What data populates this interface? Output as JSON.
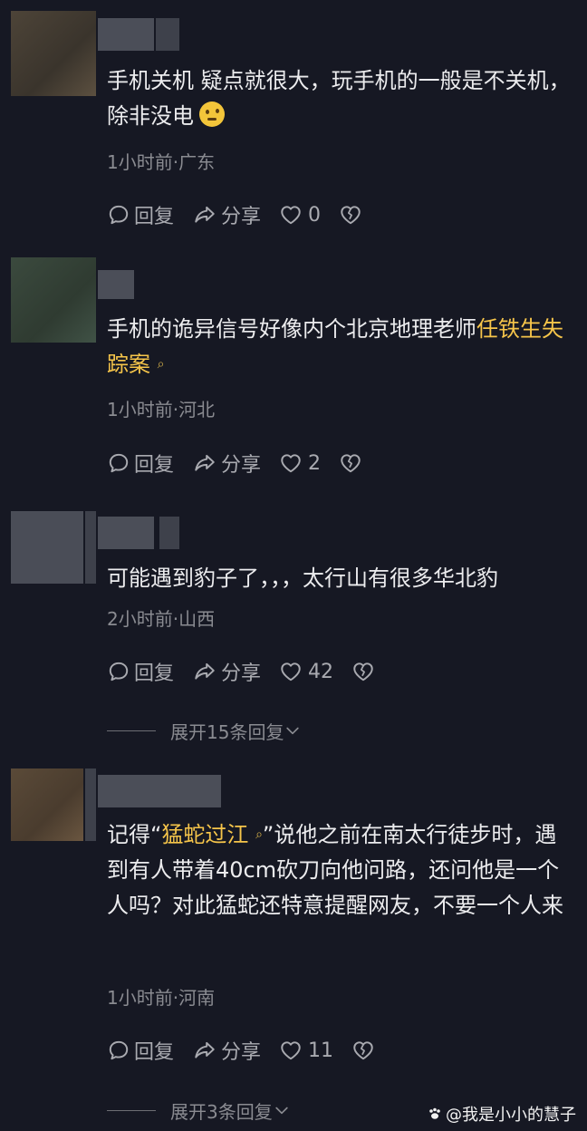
{
  "comments": [
    {
      "text": "手机关机 疑点就很大，玩手机的一般是不关机，除非没电",
      "meta": "1小时前·广东",
      "likes": "0"
    },
    {
      "text_before": "手机的诡异信号好像内个北京地理老师",
      "link": "任铁生失踪案",
      "meta": "1小时前·河北",
      "likes": "2"
    },
    {
      "text": "可能遇到豹子了，，，太行山有很多华北豹",
      "meta": "2小时前·山西",
      "likes": "42",
      "expand": "展开15条回复"
    },
    {
      "text_before": "记得“",
      "link": "猛蛇过江",
      "text_after": "”说他之前在南太行徒步时，遇到有人带着40cm砍刀向他问路，还问他是一个人吗？对此猛蛇还特意提醒网友，不要一个人来",
      "meta": "1小时前·河南",
      "likes": "11",
      "expand": "展开3条回复"
    }
  ],
  "actions": {
    "reply": "回复",
    "share": "分享"
  },
  "icons": [
    "comment-bubble-icon",
    "share-arrow-icon",
    "heart-icon",
    "broken-heart-icon",
    "chevron-down-icon",
    "search-icon",
    "thinking-face-emoji"
  ],
  "watermark": "@我是小小的慧子",
  "colors": {
    "background": "#161823",
    "highlight": "#f6c54a",
    "meta": "#8a8b91"
  }
}
